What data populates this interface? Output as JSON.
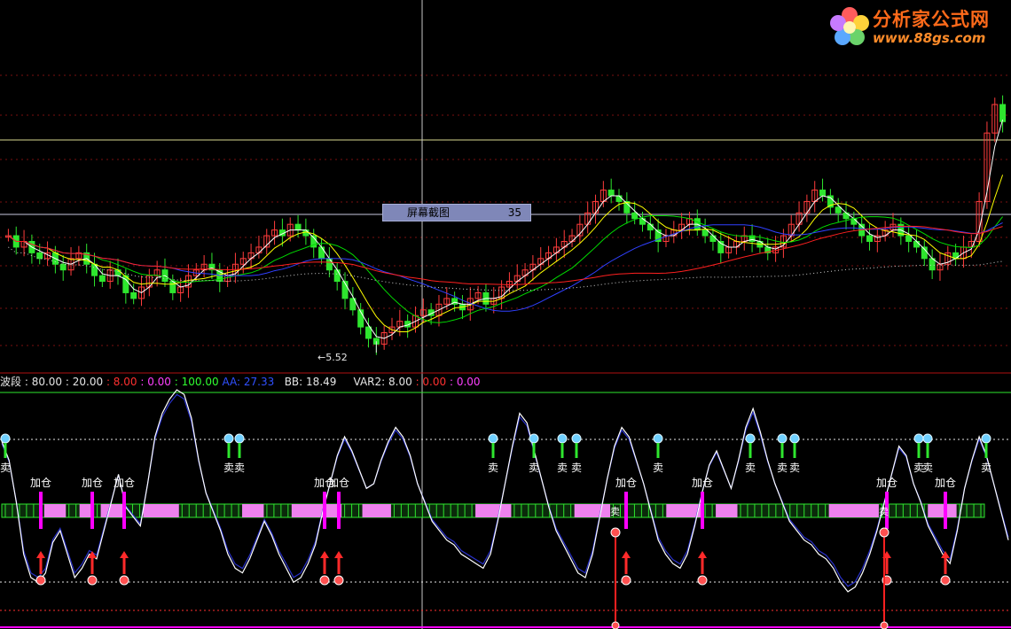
{
  "info": {
    "name": "波段",
    "p1": ": 80.00",
    "p2": ": 20.00",
    "p3": ": 8.00",
    "p4": ": 0.00",
    "p5": ": 100.00",
    "aa_label": "AA:",
    "aa_value": "27.33",
    "bb_label": "BB:",
    "bb_value": "18.49",
    "var2_label": "VAR2:",
    "var2_value": "8.00",
    "p6": ": 0.00",
    "p7": ": 0.00"
  },
  "tooltip": {
    "label": "屏幕截图",
    "value": "35"
  },
  "low_price_label": "5.52",
  "logo": {
    "text": "分析家公式网",
    "url": "www.88gs.com"
  },
  "signals": {
    "buy": "加仓",
    "sell": "卖"
  },
  "colors": {
    "up": "#ff3c3c",
    "down": "#2ee62e",
    "pink": "#ee82ee",
    "magenta": "#ff00ff",
    "ma5": "#ffffff",
    "ma10": "#ffff00",
    "ma20": "#00dd00",
    "ma30": "#3040ff",
    "ma60": "#ff2020",
    "osc": "#ffffff",
    "osc2": "#2830c8"
  },
  "chart_data": {
    "type": "candlestick-with-oscillator",
    "price": {
      "min": 5.52,
      "max": 10.8,
      "low_marker": 5.52,
      "closes": [
        7.6,
        7.4,
        7.5,
        7.3,
        7.2,
        7.3,
        7.1,
        7.0,
        7.2,
        7.3,
        7.1,
        6.9,
        6.8,
        7.0,
        6.9,
        6.6,
        6.5,
        6.7,
        6.9,
        7.0,
        6.8,
        6.6,
        6.7,
        6.9,
        7.0,
        7.1,
        7.0,
        6.8,
        6.9,
        7.1,
        7.2,
        7.3,
        7.4,
        7.6,
        7.7,
        7.6,
        7.8,
        7.7,
        7.6,
        7.4,
        7.2,
        7.0,
        6.8,
        6.5,
        6.3,
        6.0,
        5.8,
        5.7,
        5.9,
        6.0,
        6.1,
        6.0,
        6.2,
        6.3,
        6.2,
        6.4,
        6.5,
        6.4,
        6.3,
        6.5,
        6.6,
        6.4,
        6.5,
        6.7,
        6.8,
        6.9,
        7.0,
        7.1,
        7.2,
        7.3,
        7.4,
        7.5,
        7.6,
        7.8,
        8.0,
        8.2,
        8.4,
        8.3,
        8.2,
        8.0,
        7.9,
        7.8,
        7.7,
        7.5,
        7.6,
        7.7,
        7.8,
        7.9,
        7.7,
        7.6,
        7.5,
        7.3,
        7.4,
        7.5,
        7.6,
        7.5,
        7.4,
        7.3,
        7.4,
        7.6,
        7.8,
        8.0,
        8.2,
        8.4,
        8.3,
        8.1,
        8.0,
        7.9,
        7.8,
        7.6,
        7.5,
        7.6,
        7.7,
        7.8,
        7.6,
        7.5,
        7.4,
        7.2,
        7.0,
        7.1,
        7.3,
        7.2,
        7.4,
        7.5,
        8.2,
        9.4,
        9.9,
        9.6
      ]
    },
    "oscillator": {
      "min": 0,
      "max": 100,
      "levels": [
        80,
        20,
        8,
        0,
        100
      ],
      "AA": 27.33,
      "BB": 18.49,
      "VAR2": 8.0,
      "values": [
        78,
        70,
        52,
        30,
        20,
        18,
        22,
        35,
        40,
        30,
        20,
        24,
        30,
        28,
        40,
        52,
        64,
        50,
        46,
        42,
        60,
        80,
        90,
        96,
        100,
        98,
        88,
        70,
        56,
        48,
        40,
        30,
        24,
        22,
        28,
        36,
        44,
        38,
        30,
        24,
        18,
        20,
        26,
        34,
        48,
        60,
        72,
        80,
        74,
        66,
        58,
        60,
        70,
        78,
        84,
        80,
        72,
        60,
        52,
        44,
        40,
        36,
        34,
        30,
        28,
        26,
        24,
        30,
        44,
        60,
        76,
        90,
        86,
        74,
        62,
        50,
        40,
        34,
        28,
        22,
        20,
        30,
        46,
        62,
        76,
        84,
        80,
        70,
        60,
        48,
        36,
        30,
        26,
        24,
        30,
        42,
        56,
        68,
        74,
        66,
        58,
        70,
        84,
        92,
        82,
        70,
        60,
        52,
        44,
        40,
        36,
        34,
        30,
        28,
        24,
        18,
        14,
        16,
        22,
        30,
        40,
        52,
        64,
        76,
        72,
        60,
        52,
        42,
        36,
        30,
        26,
        40,
        58,
        70,
        80,
        72,
        60,
        48,
        36
      ]
    }
  }
}
